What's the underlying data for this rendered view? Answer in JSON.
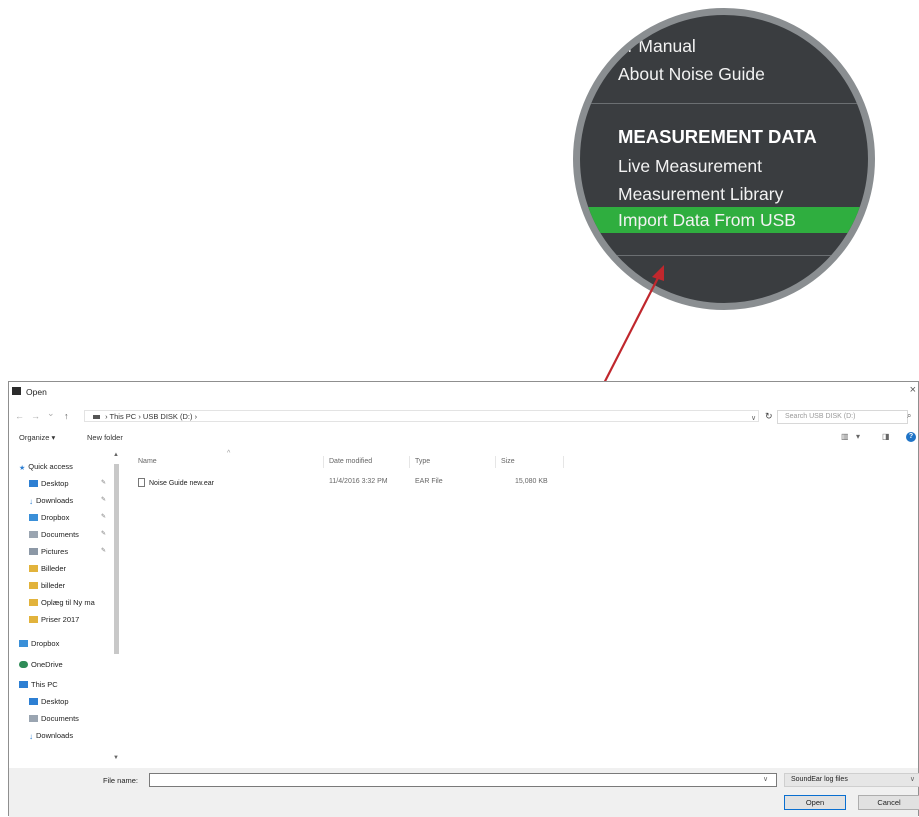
{
  "magnifier": {
    "items_top": [
      "er Manual",
      "About Noise Guide"
    ],
    "section_heading": "MEASUREMENT DATA",
    "items": [
      "Live Measurement",
      "Measurement Library",
      "Import Data From USB"
    ],
    "highlight_color": "#2fae3f"
  },
  "arrow": {
    "color": "#c0272d"
  },
  "dialog": {
    "title": "Open",
    "close_icon": "×",
    "nav": {
      "back": "←",
      "forward": "→",
      "history": "⌄",
      "up": "↑"
    },
    "breadcrumb": [
      "This PC",
      "USB DISK (D:)"
    ],
    "search_placeholder": "Search USB DISK (D:)",
    "toolbar": {
      "organize": "Organize ▾",
      "new_folder": "New folder",
      "help": "?"
    },
    "nav_pane": [
      {
        "label": "Quick access",
        "icon": "star-icon",
        "color": "#2d7fd3"
      },
      {
        "label": "Desktop",
        "icon": "desktop-icon",
        "color": "#2d7fd3",
        "pinned": true
      },
      {
        "label": "Downloads",
        "icon": "download-icon",
        "color": "#2d7fd3",
        "pinned": true
      },
      {
        "label": "Dropbox",
        "icon": "dropbox-icon",
        "color": "#3a8fd8",
        "pinned": true
      },
      {
        "label": "Documents",
        "icon": "document-icon",
        "color": "#9aa5b1",
        "pinned": true
      },
      {
        "label": "Pictures",
        "icon": "pictures-icon",
        "color": "#8c98a6",
        "pinned": true
      },
      {
        "label": "Billeder",
        "icon": "folder-icon",
        "color": "#e2b33c"
      },
      {
        "label": "billeder",
        "icon": "folder-icon",
        "color": "#e2b33c"
      },
      {
        "label": "Oplæg til Ny ma",
        "icon": "folder-icon",
        "color": "#e2b33c"
      },
      {
        "label": "Priser 2017",
        "icon": "folder-icon",
        "color": "#e2b33c"
      },
      {
        "label": "Dropbox",
        "icon": "dropbox-icon",
        "color": "#3a8fd8"
      },
      {
        "label": "OneDrive",
        "icon": "cloud-icon",
        "color": "#2e8b57"
      },
      {
        "label": "This PC",
        "icon": "computer-icon",
        "color": "#2d7fd3"
      },
      {
        "label": "Desktop",
        "icon": "desktop-icon",
        "color": "#2d7fd3"
      },
      {
        "label": "Documents",
        "icon": "document-icon",
        "color": "#9aa5b1"
      },
      {
        "label": "Downloads",
        "icon": "download-icon",
        "color": "#2d7fd3"
      }
    ],
    "columns": {
      "name": "Name",
      "date": "Date modified",
      "type": "Type",
      "size": "Size"
    },
    "files": [
      {
        "name": "Noise Guide new.ear",
        "date": "11/4/2016 3:32 PM",
        "type": "EAR File",
        "size": "15,080 KB"
      }
    ],
    "filename_label": "File name:",
    "filename_value": "",
    "filter": "SoundEar log files",
    "open_button": "Open",
    "cancel_button": "Cancel"
  }
}
